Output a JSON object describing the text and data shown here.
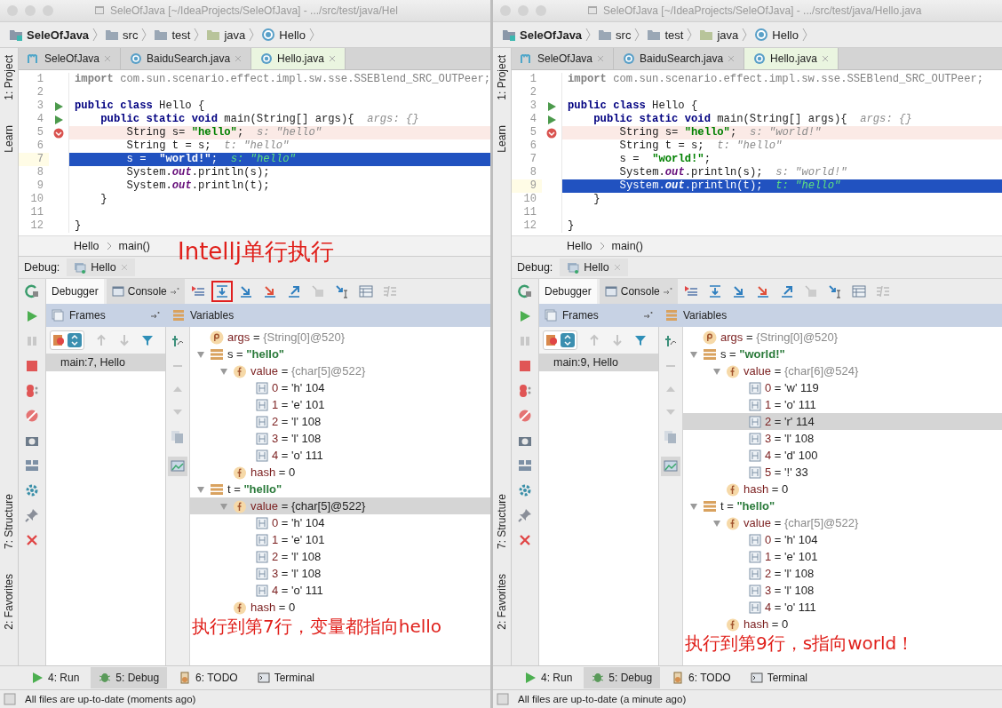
{
  "panes": [
    {
      "title": "SeleOfJava [~/IdeaProjects/SeleOfJava] - .../src/test/java/Hel",
      "breadcrumb": [
        {
          "kind": "project",
          "label": "SeleOfJava"
        },
        {
          "kind": "folder",
          "label": "src"
        },
        {
          "kind": "folder",
          "label": "test"
        },
        {
          "kind": "source",
          "label": "java"
        },
        {
          "kind": "class",
          "label": "Hello"
        }
      ],
      "tabs": [
        {
          "kind": "maven",
          "label": "SeleOfJava",
          "selected": false
        },
        {
          "kind": "class",
          "label": "BaiduSearch.java",
          "selected": false
        },
        {
          "kind": "class",
          "label": "Hello.java",
          "selected": true
        }
      ],
      "side_top": [
        "1: Project",
        "Learn"
      ],
      "side_bottom": [
        "7: Structure",
        "2: Favorites"
      ],
      "code": [
        {
          "n": "1",
          "kind": "plain",
          "tokens": [
            {
              "kind": "unused-kw",
              "text": "import"
            },
            {
              "kind": "unused",
              "text": " com.sun.scenario.effect.impl.sw.sse.SSEBlend_SRC_OUTPeer;"
            }
          ]
        },
        {
          "n": "2",
          "kind": "plain"
        },
        {
          "n": "3",
          "kind": "run",
          "tokens": [
            {
              "kind": "kw",
              "text": "public class"
            },
            {
              "kind": "text",
              "text": " Hello {"
            }
          ],
          "children": [
            {
              "n": "4",
              "kind": "run",
              "tokens": [
                {
                  "kind": "kw",
                  "text": "public static void"
                },
                {
                  "kind": "text",
                  "text": " main(String[] args){"
                }
              ],
              "hint": "args: {}",
              "children": [
                {
                  "n": "5",
                  "kind": "breakpoint",
                  "tokens": [
                    {
                      "kind": "text",
                      "text": "String s= "
                    },
                    {
                      "kind": "str",
                      "text": "\"hello\""
                    },
                    {
                      "kind": "text",
                      "text": ";"
                    }
                  ],
                  "hint": "s: \"hello\""
                },
                {
                  "n": "6",
                  "kind": "plain",
                  "tokens": [
                    {
                      "kind": "text",
                      "text": "String t = s;"
                    }
                  ],
                  "hint": "t: \"hello\""
                },
                {
                  "n": "7",
                  "kind": "current",
                  "tokens": [
                    {
                      "kind": "text",
                      "text": "s =  "
                    },
                    {
                      "kind": "str",
                      "text": "\"world!\""
                    },
                    {
                      "kind": "text",
                      "text": ";"
                    }
                  ],
                  "hint": "s: \"hello\""
                },
                {
                  "n": "8",
                  "kind": "plain",
                  "tokens": [
                    {
                      "kind": "text",
                      "text": "System."
                    },
                    {
                      "kind": "static",
                      "text": "out"
                    },
                    {
                      "kind": "text",
                      "text": ".println(s);"
                    }
                  ]
                },
                {
                  "n": "9",
                  "kind": "plain",
                  "tokens": [
                    {
                      "kind": "text",
                      "text": "System."
                    },
                    {
                      "kind": "static",
                      "text": "out"
                    },
                    {
                      "kind": "text",
                      "text": ".println(t);"
                    }
                  ]
                }
              ]
            },
            {
              "n": "10",
              "kind": "plain",
              "tokens": [
                {
                  "kind": "text",
                  "text": "}"
                }
              ]
            }
          ]
        },
        {
          "n": "11",
          "kind": "plain"
        },
        {
          "n": "12",
          "kind": "plain",
          "tokens": [
            {
              "kind": "text",
              "text": "}"
            }
          ]
        }
      ],
      "nav": [
        "Hello",
        "main()"
      ],
      "debug": {
        "label": "Debug:",
        "session": "Hello",
        "tabs": [
          {
            "kind": "debugger",
            "label": "Debugger",
            "selected": true
          },
          {
            "kind": "console",
            "label": "Console",
            "selected": false
          }
        ],
        "toolbar": [
          {
            "kind": "show-point",
            "highlighted": false
          },
          {
            "kind": "step-over",
            "highlighted": true
          },
          {
            "kind": "step-into",
            "highlighted": false
          },
          {
            "kind": "force-step-into",
            "highlighted": false
          },
          {
            "kind": "step-out",
            "highlighted": false
          },
          {
            "kind": "drop-frame",
            "highlighted": false
          },
          {
            "kind": "run-to-cursor",
            "highlighted": false
          },
          {
            "kind": "evaluate",
            "highlighted": false
          },
          {
            "kind": "trace",
            "highlighted": false
          }
        ],
        "frames_title": "Frames",
        "variables_title": "Variables",
        "frames": [
          {
            "label": "main:7, Hello",
            "selected": true
          }
        ],
        "variables": [
          {
            "kind": "param",
            "name": "args",
            "eq": "=",
            "value": {
              "kind": "ref",
              "text": "{String[0]@520}"
            },
            "selected": false
          },
          {
            "kind": "local",
            "name": "s",
            "eq": "=",
            "value": {
              "kind": "string",
              "text": "\"hello\""
            },
            "expanded": true,
            "selected": false,
            "children": [
              {
                "kind": "field",
                "name": "value",
                "eq": "=",
                "value": {
                  "kind": "ref",
                  "text": "{char[5]@522}"
                },
                "expanded": true,
                "selected": false,
                "children": [
                  {
                    "kind": "element",
                    "name": "0",
                    "eq": "=",
                    "value": {
                      "kind": "plain",
                      "text": "'h' 104"
                    },
                    "selected": false
                  },
                  {
                    "kind": "element",
                    "name": "1",
                    "eq": "=",
                    "value": {
                      "kind": "plain",
                      "text": "'e' 101"
                    },
                    "selected": false
                  },
                  {
                    "kind": "element",
                    "name": "2",
                    "eq": "=",
                    "value": {
                      "kind": "plain",
                      "text": "'l' 108"
                    },
                    "selected": false
                  },
                  {
                    "kind": "element",
                    "name": "3",
                    "eq": "=",
                    "value": {
                      "kind": "plain",
                      "text": "'l' 108"
                    },
                    "selected": false
                  },
                  {
                    "kind": "element",
                    "name": "4",
                    "eq": "=",
                    "value": {
                      "kind": "plain",
                      "text": "'o' 111"
                    },
                    "selected": false
                  }
                ]
              },
              {
                "kind": "field",
                "name": "hash",
                "eq": "=",
                "value": {
                  "kind": "plain",
                  "text": "0"
                },
                "selected": false
              }
            ]
          },
          {
            "kind": "local",
            "name": "t",
            "eq": "=",
            "value": {
              "kind": "string",
              "text": "\"hello\""
            },
            "expanded": true,
            "selected": false,
            "children": [
              {
                "kind": "field",
                "name": "value",
                "eq": "=",
                "value": {
                  "kind": "ref",
                  "text": "{char[5]@522}"
                },
                "expanded": true,
                "selected": true,
                "children": [
                  {
                    "kind": "element",
                    "name": "0",
                    "eq": "=",
                    "value": {
                      "kind": "plain",
                      "text": "'h' 104"
                    },
                    "selected": false
                  },
                  {
                    "kind": "element",
                    "name": "1",
                    "eq": "=",
                    "value": {
                      "kind": "plain",
                      "text": "'e' 101"
                    },
                    "selected": false
                  },
                  {
                    "kind": "element",
                    "name": "2",
                    "eq": "=",
                    "value": {
                      "kind": "plain",
                      "text": "'l' 108"
                    },
                    "selected": false
                  },
                  {
                    "kind": "element",
                    "name": "3",
                    "eq": "=",
                    "value": {
                      "kind": "plain",
                      "text": "'l' 108"
                    },
                    "selected": false
                  },
                  {
                    "kind": "element",
                    "name": "4",
                    "eq": "=",
                    "value": {
                      "kind": "plain",
                      "text": "'o' 111"
                    },
                    "selected": false
                  }
                ]
              },
              {
                "kind": "field",
                "name": "hash",
                "eq": "=",
                "value": {
                  "kind": "plain",
                  "text": "0"
                },
                "selected": false
              }
            ]
          }
        ]
      },
      "annotations": [
        {
          "kind": "heading",
          "text": "Intellj单行执行"
        },
        {
          "kind": "caption",
          "text": "执行到第7行，变量都指向hello"
        }
      ],
      "bottom_tabs": [
        {
          "kind": "run",
          "label": "4: Run",
          "selected": false
        },
        {
          "kind": "debug",
          "label": "5: Debug",
          "selected": true
        },
        {
          "kind": "todo",
          "label": "6: TODO",
          "selected": false
        },
        {
          "kind": "terminal",
          "label": "Terminal",
          "selected": false
        }
      ],
      "status": "All files are up-to-date (moments ago)"
    },
    {
      "title": "SeleOfJava [~/IdeaProjects/SeleOfJava] - .../src/test/java/Hello.java",
      "breadcrumb": [
        {
          "kind": "project",
          "label": "SeleOfJava"
        },
        {
          "kind": "folder",
          "label": "src"
        },
        {
          "kind": "folder",
          "label": "test"
        },
        {
          "kind": "source",
          "label": "java"
        },
        {
          "kind": "class",
          "label": "Hello"
        }
      ],
      "tabs": [
        {
          "kind": "maven",
          "label": "SeleOfJava",
          "selected": false
        },
        {
          "kind": "class",
          "label": "BaiduSearch.java",
          "selected": false
        },
        {
          "kind": "class",
          "label": "Hello.java",
          "selected": true
        }
      ],
      "side_top": [
        "1: Project",
        "Learn"
      ],
      "side_bottom": [
        "7: Structure",
        "2: Favorites"
      ],
      "code": [
        {
          "n": "1",
          "kind": "plain",
          "tokens": [
            {
              "kind": "unused-kw",
              "text": "import"
            },
            {
              "kind": "unused",
              "text": " com.sun.scenario.effect.impl.sw.sse.SSEBlend_SRC_OUTPeer;"
            }
          ]
        },
        {
          "n": "2",
          "kind": "plain"
        },
        {
          "n": "3",
          "kind": "run",
          "tokens": [
            {
              "kind": "kw",
              "text": "public class"
            },
            {
              "kind": "text",
              "text": " Hello {"
            }
          ],
          "children": [
            {
              "n": "4",
              "kind": "run",
              "tokens": [
                {
                  "kind": "kw",
                  "text": "public static void"
                },
                {
                  "kind": "text",
                  "text": " main(String[] args){"
                }
              ],
              "hint": "args: {}",
              "children": [
                {
                  "n": "5",
                  "kind": "breakpoint",
                  "tokens": [
                    {
                      "kind": "text",
                      "text": "String s= "
                    },
                    {
                      "kind": "str",
                      "text": "\"hello\""
                    },
                    {
                      "kind": "text",
                      "text": ";"
                    }
                  ],
                  "hint": "s: \"world!\""
                },
                {
                  "n": "6",
                  "kind": "plain",
                  "tokens": [
                    {
                      "kind": "text",
                      "text": "String t = s;"
                    }
                  ],
                  "hint": "t: \"hello\""
                },
                {
                  "n": "7",
                  "kind": "plain",
                  "tokens": [
                    {
                      "kind": "text",
                      "text": "s =  "
                    },
                    {
                      "kind": "str",
                      "text": "\"world!\""
                    },
                    {
                      "kind": "text",
                      "text": ";"
                    }
                  ]
                },
                {
                  "n": "8",
                  "kind": "plain",
                  "tokens": [
                    {
                      "kind": "text",
                      "text": "System."
                    },
                    {
                      "kind": "static",
                      "text": "out"
                    },
                    {
                      "kind": "text",
                      "text": ".println(s);"
                    }
                  ],
                  "hint": "s: \"world!\""
                },
                {
                  "n": "9",
                  "kind": "current",
                  "tokens": [
                    {
                      "kind": "text",
                      "text": "System."
                    },
                    {
                      "kind": "static",
                      "text": "out"
                    },
                    {
                      "kind": "text",
                      "text": ".println(t);"
                    }
                  ],
                  "hint": "t: \"hello\""
                }
              ]
            },
            {
              "n": "10",
              "kind": "plain",
              "tokens": [
                {
                  "kind": "text",
                  "text": "}"
                }
              ]
            }
          ]
        },
        {
          "n": "11",
          "kind": "plain"
        },
        {
          "n": "12",
          "kind": "plain",
          "tokens": [
            {
              "kind": "text",
              "text": "}"
            }
          ]
        }
      ],
      "nav": [
        "Hello",
        "main()"
      ],
      "debug": {
        "label": "Debug:",
        "session": "Hello",
        "tabs": [
          {
            "kind": "debugger",
            "label": "Debugger",
            "selected": true
          },
          {
            "kind": "console",
            "label": "Console",
            "selected": false
          }
        ],
        "toolbar": [
          {
            "kind": "show-point",
            "highlighted": false
          },
          {
            "kind": "step-over",
            "highlighted": false
          },
          {
            "kind": "step-into",
            "highlighted": false
          },
          {
            "kind": "force-step-into",
            "highlighted": false
          },
          {
            "kind": "step-out",
            "highlighted": false
          },
          {
            "kind": "drop-frame",
            "highlighted": false
          },
          {
            "kind": "run-to-cursor",
            "highlighted": false
          },
          {
            "kind": "evaluate",
            "highlighted": false
          },
          {
            "kind": "trace",
            "highlighted": false
          }
        ],
        "frames_title": "Frames",
        "variables_title": "Variables",
        "frames": [
          {
            "label": "main:9, Hello",
            "selected": true
          }
        ],
        "variables": [
          {
            "kind": "param",
            "name": "args",
            "eq": "=",
            "value": {
              "kind": "ref",
              "text": "{String[0]@520}"
            },
            "selected": false
          },
          {
            "kind": "local",
            "name": "s",
            "eq": "=",
            "value": {
              "kind": "string",
              "text": "\"world!\""
            },
            "expanded": true,
            "selected": false,
            "children": [
              {
                "kind": "field",
                "name": "value",
                "eq": "=",
                "value": {
                  "kind": "ref",
                  "text": "{char[6]@524}"
                },
                "expanded": true,
                "selected": false,
                "children": [
                  {
                    "kind": "element",
                    "name": "0",
                    "eq": "=",
                    "value": {
                      "kind": "plain",
                      "text": "'w' 119"
                    },
                    "selected": false
                  },
                  {
                    "kind": "element",
                    "name": "1",
                    "eq": "=",
                    "value": {
                      "kind": "plain",
                      "text": "'o' 111"
                    },
                    "selected": false
                  },
                  {
                    "kind": "element",
                    "name": "2",
                    "eq": "=",
                    "value": {
                      "kind": "plain",
                      "text": "'r' 114"
                    },
                    "selected": true
                  },
                  {
                    "kind": "element",
                    "name": "3",
                    "eq": "=",
                    "value": {
                      "kind": "plain",
                      "text": "'l' 108"
                    },
                    "selected": false
                  },
                  {
                    "kind": "element",
                    "name": "4",
                    "eq": "=",
                    "value": {
                      "kind": "plain",
                      "text": "'d' 100"
                    },
                    "selected": false
                  },
                  {
                    "kind": "element",
                    "name": "5",
                    "eq": "=",
                    "value": {
                      "kind": "plain",
                      "text": "'!' 33"
                    },
                    "selected": false
                  }
                ]
              },
              {
                "kind": "field",
                "name": "hash",
                "eq": "=",
                "value": {
                  "kind": "plain",
                  "text": "0"
                },
                "selected": false
              }
            ]
          },
          {
            "kind": "local",
            "name": "t",
            "eq": "=",
            "value": {
              "kind": "string",
              "text": "\"hello\""
            },
            "expanded": true,
            "selected": false,
            "children": [
              {
                "kind": "field",
                "name": "value",
                "eq": "=",
                "value": {
                  "kind": "ref",
                  "text": "{char[5]@522}"
                },
                "expanded": true,
                "selected": false,
                "children": [
                  {
                    "kind": "element",
                    "name": "0",
                    "eq": "=",
                    "value": {
                      "kind": "plain",
                      "text": "'h' 104"
                    },
                    "selected": false
                  },
                  {
                    "kind": "element",
                    "name": "1",
                    "eq": "=",
                    "value": {
                      "kind": "plain",
                      "text": "'e' 101"
                    },
                    "selected": false
                  },
                  {
                    "kind": "element",
                    "name": "2",
                    "eq": "=",
                    "value": {
                      "kind": "plain",
                      "text": "'l' 108"
                    },
                    "selected": false
                  },
                  {
                    "kind": "element",
                    "name": "3",
                    "eq": "=",
                    "value": {
                      "kind": "plain",
                      "text": "'l' 108"
                    },
                    "selected": false
                  },
                  {
                    "kind": "element",
                    "name": "4",
                    "eq": "=",
                    "value": {
                      "kind": "plain",
                      "text": "'o' 111"
                    },
                    "selected": false
                  }
                ]
              },
              {
                "kind": "field",
                "name": "hash",
                "eq": "=",
                "value": {
                  "kind": "plain",
                  "text": "0"
                },
                "selected": false
              }
            ]
          }
        ]
      },
      "annotations": [
        {
          "kind": "caption",
          "text": "执行到第9行，s指向world！"
        }
      ],
      "bottom_tabs": [
        {
          "kind": "run",
          "label": "4: Run",
          "selected": false
        },
        {
          "kind": "debug",
          "label": "5: Debug",
          "selected": true
        },
        {
          "kind": "todo",
          "label": "6: TODO",
          "selected": false
        },
        {
          "kind": "terminal",
          "label": "Terminal",
          "selected": false
        }
      ],
      "status": "All files are up-to-date (a minute ago)"
    }
  ]
}
